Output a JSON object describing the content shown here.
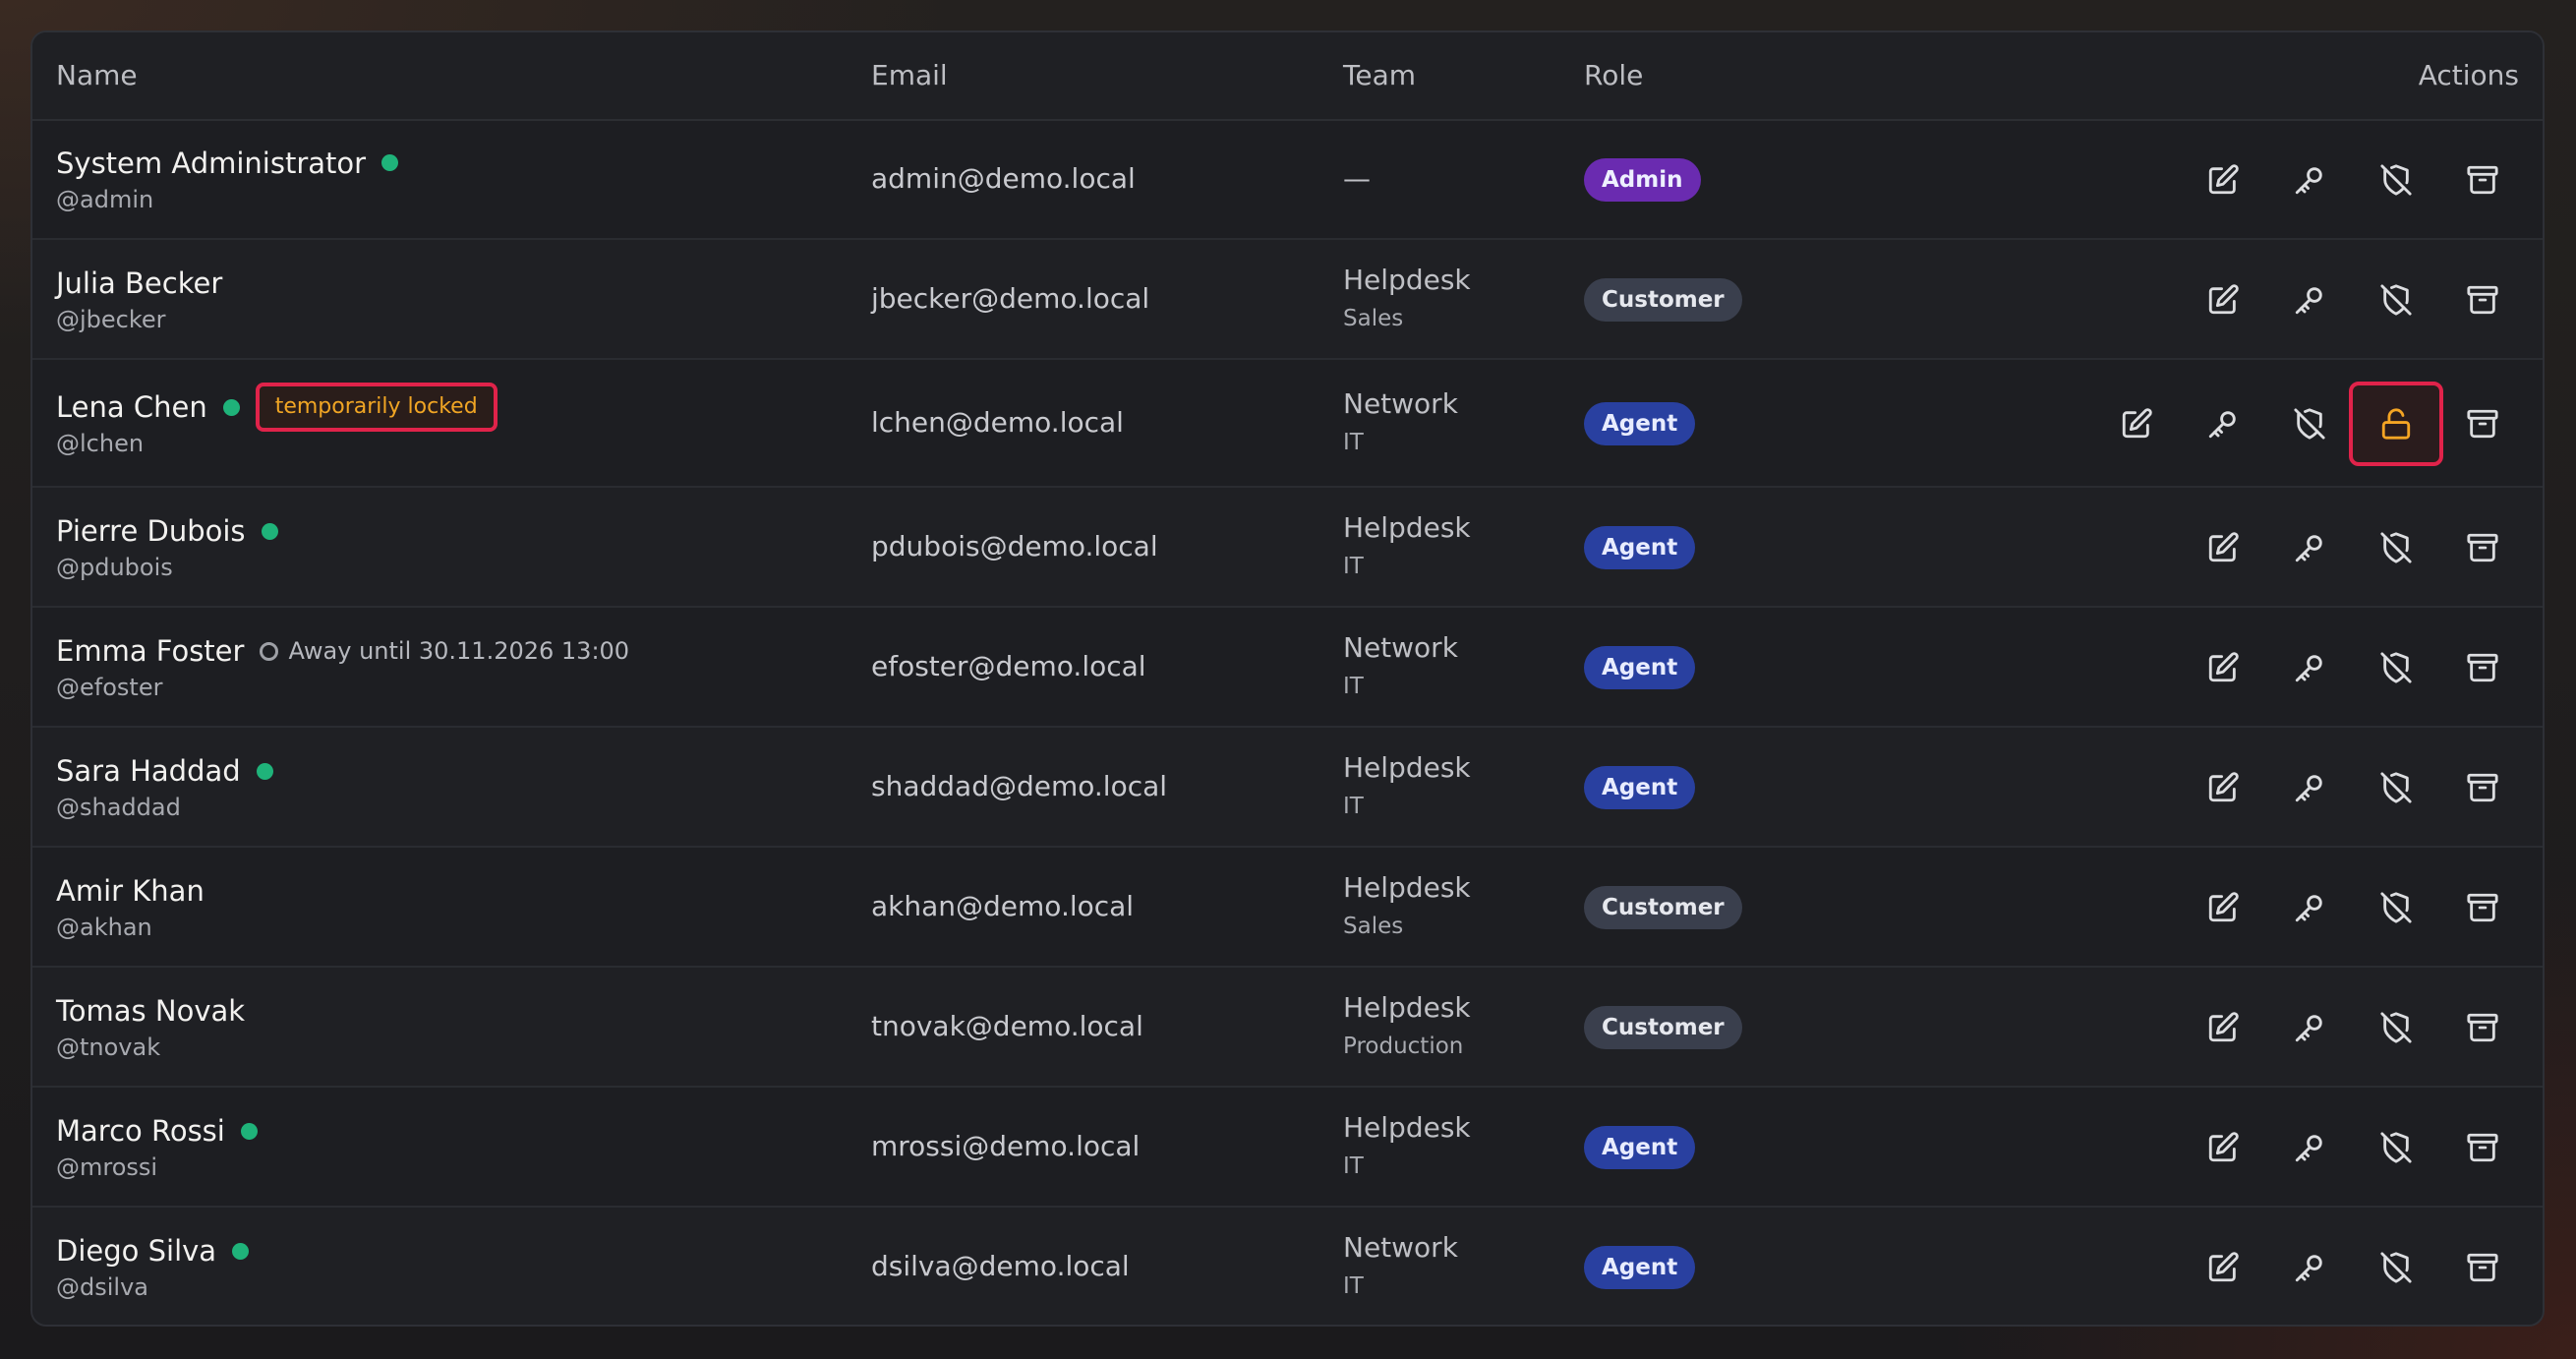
{
  "table": {
    "headers": {
      "name": "Name",
      "email": "Email",
      "team": "Team",
      "role": "Role",
      "actions": "Actions"
    },
    "rows": [
      {
        "name": "System Administrator",
        "handle": "@admin",
        "status": "online",
        "email": "admin@demo.local",
        "team": "—",
        "subteam": "",
        "role": "Admin"
      },
      {
        "name": "Julia Becker",
        "handle": "@jbecker",
        "status": "none",
        "email": "jbecker@demo.local",
        "team": "Helpdesk",
        "subteam": "Sales",
        "role": "Customer"
      },
      {
        "name": "Lena Chen",
        "handle": "@lchen",
        "status": "online",
        "badge": "temporarily locked",
        "email": "lchen@demo.local",
        "team": "Network",
        "subteam": "IT",
        "role": "Agent",
        "extra_action": "unlock-icon"
      },
      {
        "name": "Pierre Dubois",
        "handle": "@pdubois",
        "status": "online",
        "email": "pdubois@demo.local",
        "team": "Helpdesk",
        "subteam": "IT",
        "role": "Agent"
      },
      {
        "name": "Emma Foster",
        "handle": "@efoster",
        "status": "away",
        "away_text": "Away until 30.11.2026 13:00",
        "email": "efoster@demo.local",
        "team": "Network",
        "subteam": "IT",
        "role": "Agent"
      },
      {
        "name": "Sara Haddad",
        "handle": "@shaddad",
        "status": "online",
        "email": "shaddad@demo.local",
        "team": "Helpdesk",
        "subteam": "IT",
        "role": "Agent"
      },
      {
        "name": "Amir Khan",
        "handle": "@akhan",
        "status": "none",
        "email": "akhan@demo.local",
        "team": "Helpdesk",
        "subteam": "Sales",
        "role": "Customer"
      },
      {
        "name": "Tomas Novak",
        "handle": "@tnovak",
        "status": "none",
        "email": "tnovak@demo.local",
        "team": "Helpdesk",
        "subteam": "Production",
        "role": "Customer"
      },
      {
        "name": "Marco Rossi",
        "handle": "@mrossi",
        "status": "online",
        "email": "mrossi@demo.local",
        "team": "Helpdesk",
        "subteam": "IT",
        "role": "Agent"
      },
      {
        "name": "Diego Silva",
        "handle": "@dsilva",
        "status": "online",
        "email": "dsilva@demo.local",
        "team": "Network",
        "subteam": "IT",
        "role": "Agent"
      }
    ],
    "action_icons": [
      "edit-icon",
      "key-icon",
      "shield-off-icon",
      "archive-icon"
    ]
  },
  "colors": {
    "online": "#1fb37a",
    "admin_badge": "#6a2bb0",
    "agent_badge": "#2940a0",
    "customer_badge": "#3a3f4d",
    "locked_text": "#f0a524",
    "highlight_border": "#e0234a"
  }
}
